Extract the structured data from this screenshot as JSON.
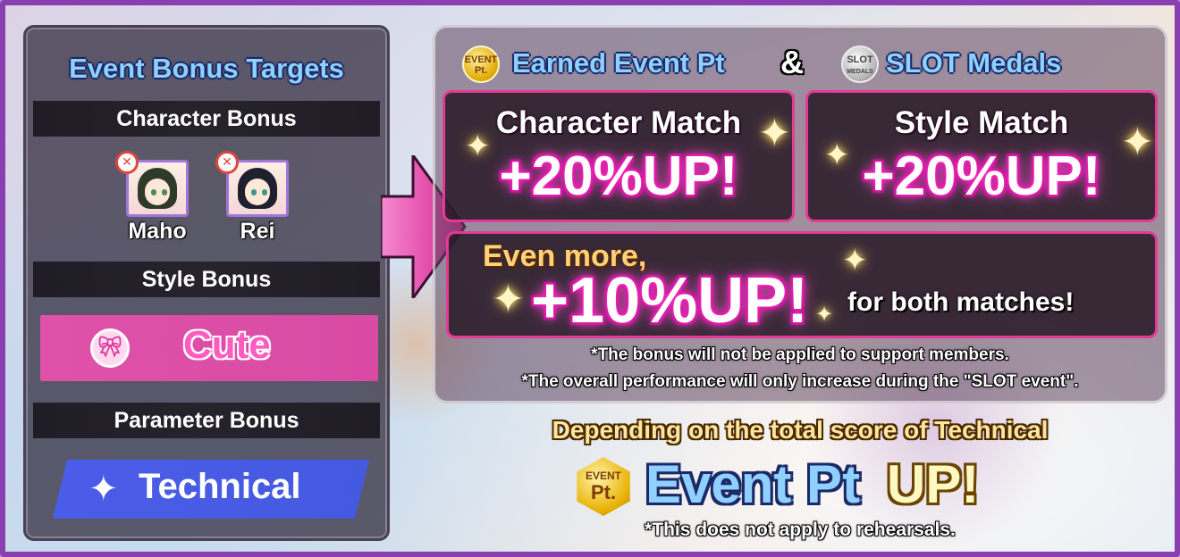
{
  "left_panel": {
    "title": "Event Bonus Targets",
    "character_bonus_header": "Character Bonus",
    "characters": [
      {
        "name": "Maho",
        "hair_color": "#2f3a2a",
        "eye_color": "#4a8a5a"
      },
      {
        "name": "Rei",
        "hair_color": "#1f1f2e",
        "eye_color": "#3a9a8a"
      }
    ],
    "style_bonus_header": "Style Bonus",
    "style": {
      "label": "Cute",
      "icon": "ribbon-icon",
      "color": "#e052a9"
    },
    "parameter_bonus_header": "Parameter Bonus",
    "parameter": {
      "label": "Technical",
      "icon": "sparkle-star-icon",
      "color": "#4b5de8"
    }
  },
  "right_panel": {
    "heading_left": "Earned Event Pt",
    "heading_amp": "&",
    "heading_right": "SLOT Medals",
    "event_coin": {
      "line1": "EVENT",
      "line2": "Pt."
    },
    "slot_coin": {
      "line1": "SLOT",
      "line2": "MEDALS"
    },
    "character_match": {
      "title": "Character Match",
      "bonus": "+20%UP!"
    },
    "style_match": {
      "title": "Style Match",
      "bonus": "+20%UP!"
    },
    "extra": {
      "prefix": "Even more,",
      "bonus": "+10%UP!",
      "suffix": "for both matches!"
    },
    "note1": "*The bonus will not be applied to support members.",
    "note2": "*The overall performance will only increase during the \"SLOT event\"."
  },
  "bottom": {
    "depending": "Depending on the total score of Technical",
    "coin": {
      "line1": "EVENT",
      "line2": "Pt."
    },
    "event_pt": "Event Pt",
    "up": "UP!",
    "rehearsal_note": "*This does not apply to rehearsals."
  },
  "colors": {
    "frame": "#8a3fb0",
    "accent_pink": "#e43a96",
    "heading_blue": "#8fd0ff"
  }
}
